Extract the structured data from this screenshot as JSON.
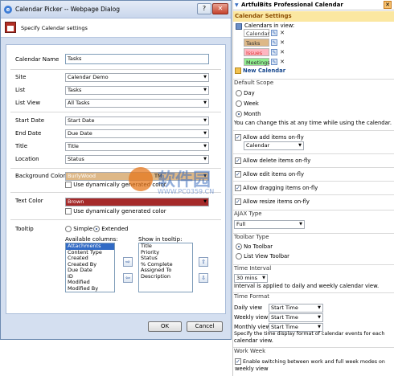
{
  "dialog": {
    "title": "Calendar Picker -- Webpage Dialog",
    "header_text": "Specify Calendar settings",
    "fields": {
      "calendar_name_label": "Calendar Name",
      "calendar_name_value": "Tasks",
      "site_label": "Site",
      "site_value": "Calendar Demo",
      "list_label": "List",
      "list_value": "Tasks",
      "list_view_label": "List View",
      "list_view_value": "All Tasks",
      "start_date_label": "Start Date",
      "start_date_value": "Start Date",
      "end_date_label": "End Date",
      "end_date_value": "Due Date",
      "title_label": "Title",
      "title_value": "Title",
      "location_label": "Location",
      "location_value": "Status",
      "bg_color_label": "Background Color",
      "bg_color_value": "BurlyWood",
      "bg_color_hex": "#deb887",
      "bg_tm": "TM",
      "bg_dynamic_label": "Use dynamically generated color",
      "text_color_label": "Text Color",
      "text_color_value": "Brown",
      "text_color_hex": "#a52a2a",
      "text_dynamic_label": "Use dynamically generated color",
      "tooltip_label": "Tooltip",
      "tooltip_simple": "Simple",
      "tooltip_extended": "Extended",
      "available_columns_label": "Available columns:",
      "show_in_tooltip_label": "Show in tooltip:",
      "available_columns": [
        "Attachments",
        "Content Type",
        "Created",
        "Created By",
        "Due Date",
        "ID",
        "Modified",
        "Modified By"
      ],
      "tooltip_columns": [
        "Title",
        "Priority",
        "Status",
        "% Complete",
        "Assigned To",
        "Description"
      ]
    },
    "ok_label": "OK",
    "cancel_label": "Cancel"
  },
  "panel": {
    "title": "ArtfulBits Professional Calendar",
    "settings_header": "Calendar Settings",
    "calendars_in_view_label": "Calendars in view:",
    "calendars": [
      {
        "name": "Calendar",
        "color": "#ffffff"
      },
      {
        "name": "Tasks",
        "color": "#deb887"
      },
      {
        "name": "Issues",
        "color": "#ffb6c1"
      },
      {
        "name": "Meetings",
        "color": "#90ee90"
      }
    ],
    "new_calendar": "New Calendar",
    "default_scope_label": "Default Scope",
    "scope_day": "Day",
    "scope_week": "Week",
    "scope_month": "Month",
    "scope_note": "You can change this at any time while using the calendar.",
    "allow_add_label": "Allow add items on-fly",
    "allow_add_value": "Calendar",
    "allow_delete_label": "Allow delete items on-fly",
    "allow_edit_label": "Allow edit items on-fly",
    "allow_drag_label": "Allow dragging items on-fly",
    "allow_resize_label": "Allow resize items on-fly",
    "ajax_type_label": "AJAX Type",
    "ajax_type_value": "Full",
    "toolbar_type_label": "Toolbar Type",
    "toolbar_none": "No Toolbar",
    "toolbar_list": "List View Toolbar",
    "time_interval_label": "Time Interval",
    "time_interval_value": "30 mins",
    "time_interval_note": "Interval is applied to daily and weekly calendar view.",
    "time_format_label": "Time Format",
    "daily_view_label": "Daily view",
    "weekly_view_label": "Weekly view",
    "monthly_view_label": "Monthly view",
    "daily_view_value": "Start Time",
    "weekly_view_value": "Start Time",
    "monthly_view_value": "Start Time",
    "time_format_note_1": "Specify the time display format of calendar events for each",
    "time_format_note_2": "calendar view.",
    "work_week_label": "Work Week",
    "work_week_note_1": "Enable switching between work and full week modes on",
    "work_week_note_2": "weekly view"
  },
  "watermark": {
    "main": "软件园",
    "sub": "WWW.PC0359.CN"
  }
}
